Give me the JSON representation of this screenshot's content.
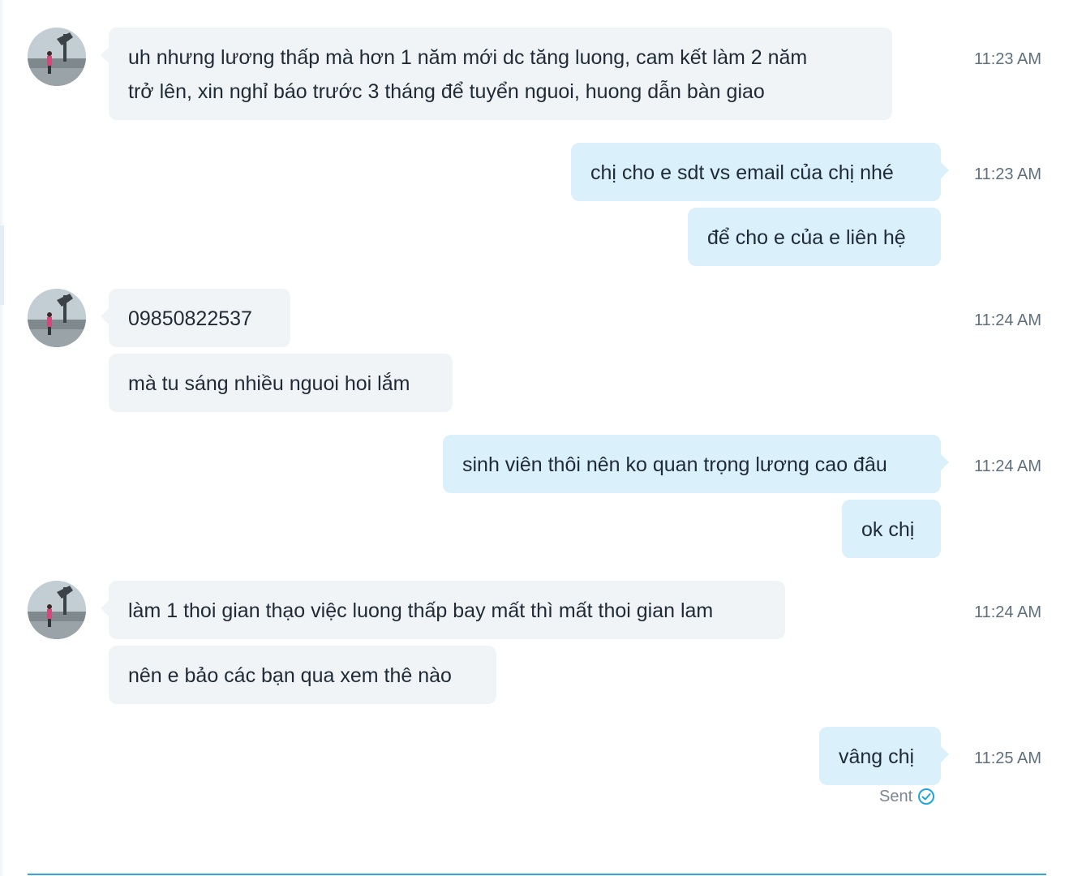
{
  "colors": {
    "incoming_bubble": "#f1f4f7",
    "outgoing_bubble": "#daf1fb",
    "timestamp": "#5f6f7d",
    "accent": "#34a6dc"
  },
  "messages": [
    {
      "side": "in",
      "time": "11:23 AM",
      "lines": [
        "uh nhưng lương thấp mà hơn 1 năm mới dc tăng luong, cam kết làm 2 năm",
        "trở lên, xin nghỉ báo trước 3 tháng để tuyển nguoi, huong dẫn bàn giao"
      ]
    },
    {
      "side": "out",
      "time": "11:23 AM",
      "lines": [
        "chị cho e sdt vs email của chị nhé"
      ]
    },
    {
      "side": "out",
      "time": "",
      "lines": [
        "để cho e của e liên hệ"
      ]
    },
    {
      "side": "in",
      "time": "11:24 AM",
      "lines": [
        "09850822537"
      ]
    },
    {
      "side": "in",
      "time": "",
      "lines": [
        "mà tu sáng nhiều nguoi hoi lắm"
      ]
    },
    {
      "side": "out",
      "time": "11:24 AM",
      "lines": [
        "sinh viên thôi nên ko quan trọng lương cao đâu"
      ]
    },
    {
      "side": "out",
      "time": "",
      "lines": [
        "ok chị"
      ]
    },
    {
      "side": "in",
      "time": "11:24 AM",
      "lines": [
        "làm 1 thoi gian thạo việc luong thấp bay mất thì mất thoi gian lam"
      ]
    },
    {
      "side": "in",
      "time": "",
      "lines": [
        "nên e bảo các bạn qua xem thê nào"
      ]
    },
    {
      "side": "out",
      "time": "11:25 AM",
      "lines": [
        "vâng chị"
      ]
    }
  ],
  "status": {
    "label": "Sent",
    "icon": "check-circle-icon"
  }
}
